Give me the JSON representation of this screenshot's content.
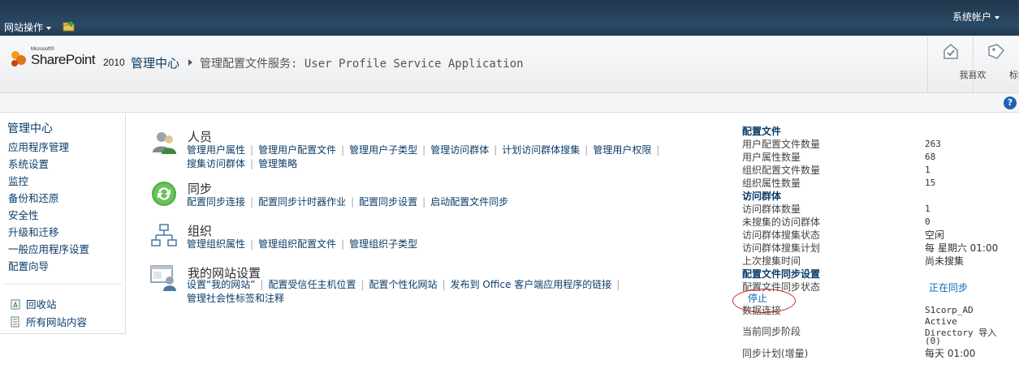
{
  "topbar": {
    "site_actions": "网站操作",
    "account": "系统帐户"
  },
  "title": {
    "logo_small": "Microsoft®",
    "logo_main": "SharePoint",
    "logo_year": "2010",
    "breadcrumb_root": "管理中心",
    "breadcrumb_page": "管理配置文件服务: User Profile Service Application"
  },
  "social": {
    "like": "我喜欢",
    "tags": "标签"
  },
  "help": "?",
  "leftnav": {
    "heading": "管理中心",
    "items": [
      "应用程序管理",
      "系统设置",
      "监控",
      "备份和还原",
      "安全性",
      "升级和迁移",
      "一般应用程序设置",
      "配置向导"
    ],
    "footer": [
      "回收站",
      "所有网站内容"
    ]
  },
  "sections": {
    "people": {
      "title": "人员",
      "row1": [
        "管理用户属性",
        "管理用户配置文件",
        "管理用户子类型",
        "管理访问群体",
        "计划访问群体搜集",
        "管理用户权限"
      ],
      "row2": [
        "搜集访问群体",
        "管理策略"
      ]
    },
    "sync": {
      "title": "同步",
      "row1": [
        "配置同步连接",
        "配置同步计时器作业",
        "配置同步设置",
        "启动配置文件同步"
      ]
    },
    "org": {
      "title": "组织",
      "row1": [
        "管理组织属性",
        "管理组织配置文件",
        "管理组织子类型"
      ]
    },
    "mysite": {
      "title": "我的网站设置",
      "row1": [
        "设置“我的网站”",
        "配置受信任主机位置",
        "配置个性化网站",
        "发布到 Office 客户端应用程序的链接"
      ],
      "row2": [
        "管理社会性标签和注释"
      ]
    }
  },
  "panel": {
    "profiles_head": "配置文件",
    "user_profiles_label": "用户配置文件数量",
    "user_profiles_value": "263",
    "user_props_label": "用户属性数量",
    "user_props_value": "68",
    "org_profiles_label": "组织配置文件数量",
    "org_profiles_value": "1",
    "org_props_label": "组织属性数量",
    "org_props_value": "15",
    "audience_head": "访问群体",
    "audience_count_label": "访问群体数量",
    "audience_count_value": "1",
    "uncompiled_label": "未搜集的访问群体",
    "uncompiled_value": "0",
    "compile_status_label": "访问群体搜集状态",
    "compile_status_value": "空闲",
    "compile_schedule_label": "访问群体搜集计划",
    "compile_schedule_value": "每 星期六 01:00",
    "last_compile_label": "上次搜集时间",
    "last_compile_value": "尚未搜集",
    "sync_head": "配置文件同步设置",
    "sync_status_label": "配置文件同步状态",
    "sync_status_value": "正在同步",
    "stop_link": "停止",
    "data_conn_label": "数据连接",
    "data_conn_value_1": "S1corp_AD",
    "data_conn_value_2": "Active",
    "data_conn_value_3": "Directory 导入",
    "data_conn_value_4": "(0)",
    "stage_label": "当前同步阶段",
    "schedule_label": "同步计划(增量)",
    "schedule_value": "每天 01:00"
  },
  "colors": {
    "link": "#0b3d68",
    "topbar": "#21374c",
    "annotation": "#d0202a"
  }
}
